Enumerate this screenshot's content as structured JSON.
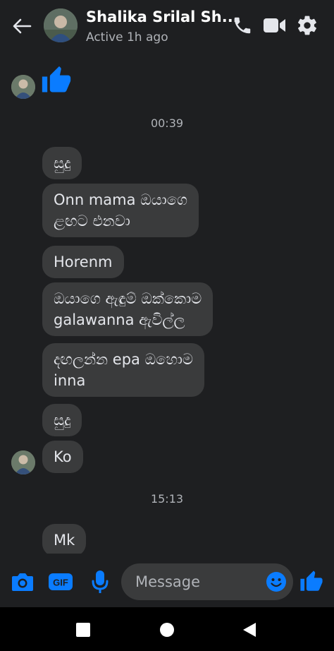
{
  "header": {
    "back_icon": "arrow-left-icon",
    "contact_name": "Shalika Srilal Sh...",
    "status": "Active 1h ago",
    "call_icon": "phone-icon",
    "video_icon": "video-camera-icon",
    "settings_icon": "gear-icon"
  },
  "messages": [
    {
      "type": "like",
      "from": "contact",
      "icon": "thumbs-up-icon"
    },
    {
      "type": "timestamp",
      "text": "00:39"
    },
    {
      "type": "text",
      "from": "contact",
      "text": "සුදු"
    },
    {
      "type": "text",
      "from": "contact",
      "text": "Onn mama ඔයාගෙ\nළඟට එනවා"
    },
    {
      "type": "text",
      "from": "contact",
      "text": "Horenm"
    },
    {
      "type": "text",
      "from": "contact",
      "text": "ඔයාගෙ ඇඳුම් ඔක්කොම\ngalawanna ඇවිල්ල"
    },
    {
      "type": "text",
      "from": "contact",
      "text": "දඟලන්න epa ඔහොම\ninna"
    },
    {
      "type": "text",
      "from": "contact",
      "text": "සුදු"
    },
    {
      "type": "text",
      "from": "contact",
      "text": "Ko"
    },
    {
      "type": "timestamp",
      "text": "15:13"
    },
    {
      "type": "text",
      "from": "contact",
      "text": "Mk"
    }
  ],
  "composer": {
    "camera_icon": "camera-icon",
    "gif_label": "GIF",
    "mic_icon": "microphone-icon",
    "placeholder": "Message",
    "emoji_icon": "smiley-icon",
    "like_icon": "thumbs-up-icon"
  },
  "navbar": {
    "recents_icon": "square-icon",
    "home_icon": "circle-icon",
    "back_icon": "triangle-back-icon"
  },
  "colors": {
    "accent": "#0a7cff",
    "background": "#1e1f21",
    "bubble": "#3a3b3c",
    "text": "#e4e6eb",
    "muted": "#b0b3b8"
  }
}
